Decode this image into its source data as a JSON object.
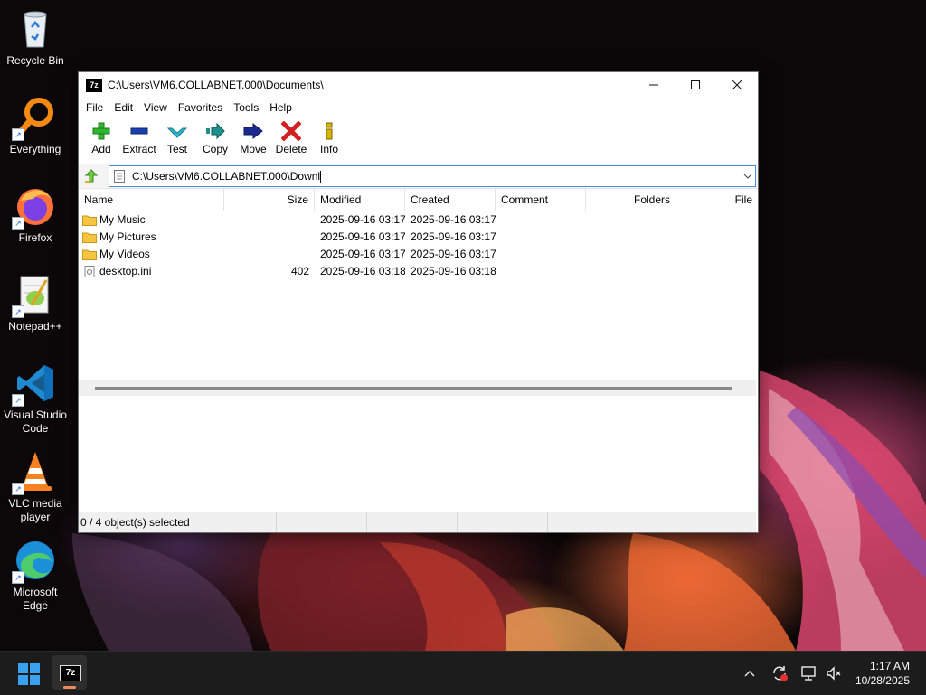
{
  "desktop": {
    "icons": [
      {
        "label": "Recycle Bin",
        "icon": "recycle-bin-icon"
      },
      {
        "label": "Everything",
        "icon": "everything-search-icon"
      },
      {
        "label": "Firefox",
        "icon": "firefox-icon"
      },
      {
        "label": "Notepad++",
        "icon": "notepadpp-icon"
      },
      {
        "label": "Visual Studio Code",
        "icon": "vscode-icon"
      },
      {
        "label": "VLC media player",
        "icon": "vlc-icon"
      },
      {
        "label": "Microsoft Edge",
        "icon": "edge-icon"
      }
    ]
  },
  "window": {
    "app_icon": "7z",
    "title": "C:\\Users\\VM6.COLLABNET.000\\Documents\\",
    "controls": {
      "minimize": "—",
      "maximize": "☐",
      "close": "✕"
    },
    "menu": [
      "File",
      "Edit",
      "View",
      "Favorites",
      "Tools",
      "Help"
    ],
    "toolbar": [
      {
        "label": "Add",
        "icon": "plus-icon",
        "color": "#2fb52f"
      },
      {
        "label": "Extract",
        "icon": "minus-icon",
        "color": "#1a3fb0"
      },
      {
        "label": "Test",
        "icon": "check-icon",
        "color": "#29b7c9"
      },
      {
        "label": "Copy",
        "icon": "arrow-right-teal-icon",
        "color": "#1e8f8a"
      },
      {
        "label": "Move",
        "icon": "arrow-right-blue-icon",
        "color": "#1b2a8f"
      },
      {
        "label": "Delete",
        "icon": "x-icon",
        "color": "#d21f1f"
      },
      {
        "label": "Info",
        "icon": "info-icon",
        "color": "#d9b400"
      }
    ],
    "address": {
      "value": "C:\\Users\\VM6.COLLABNET.000\\Downl"
    },
    "columns": {
      "name": "Name",
      "size": "Size",
      "modified": "Modified",
      "created": "Created",
      "comment": "Comment",
      "folders": "Folders",
      "files": "File"
    },
    "rows": [
      {
        "name": "My Music",
        "type": "folder",
        "size": "",
        "modified": "2025-09-16 03:17",
        "created": "2025-09-16 03:17"
      },
      {
        "name": "My Pictures",
        "type": "folder",
        "size": "",
        "modified": "2025-09-16 03:17",
        "created": "2025-09-16 03:17"
      },
      {
        "name": "My Videos",
        "type": "folder",
        "size": "",
        "modified": "2025-09-16 03:17",
        "created": "2025-09-16 03:17"
      },
      {
        "name": "desktop.ini",
        "type": "file",
        "size": "402",
        "modified": "2025-09-16 03:18",
        "created": "2025-09-16 03:18"
      }
    ],
    "status": {
      "selection": "0 / 4 object(s) selected"
    }
  },
  "taskbar": {
    "start_icon": "windows-start-icon",
    "pinned": [
      {
        "label": "7z",
        "icon": "7zip-taskbar-icon"
      }
    ],
    "tray": {
      "chevron": "^"
    },
    "clock": {
      "time": "1:17 AM",
      "date": "10/28/2025"
    }
  }
}
